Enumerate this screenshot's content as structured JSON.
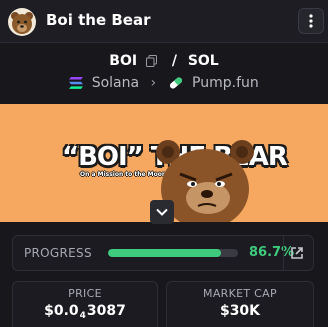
{
  "header": {
    "title": "Boi the Bear",
    "avatar_icon": "bear-avatar-icon",
    "menu_icon": "more-vertical-icon"
  },
  "pair": {
    "base": "BOI",
    "separator": "/",
    "quote": "SOL",
    "copy_icon": "copy-icon"
  },
  "breadcrumb": {
    "chain": "Solana",
    "chain_icon": "solana-icon",
    "chevron": "›",
    "dex": "Pump.fun",
    "dex_icon": "pill-icon"
  },
  "banner": {
    "title": "“BOI” THE BEAR",
    "tagline": "On a Mission to the Moon with Boi",
    "expand_icon": "chevron-down-icon"
  },
  "progress": {
    "label": "PROGRESS",
    "value_text": "86.7%",
    "fraction": 0.867,
    "link_icon": "external-link-icon"
  },
  "stats": {
    "price_label": "PRICE",
    "price_prefix": "$0.0",
    "price_zeros": "4",
    "price_digits": "3087",
    "mcap_label": "MARKET CAP",
    "mcap_value": "$30K"
  },
  "colors": {
    "accent_green": "#3ecb7e",
    "banner_bg": "#f6a860",
    "background": "#17171c"
  }
}
